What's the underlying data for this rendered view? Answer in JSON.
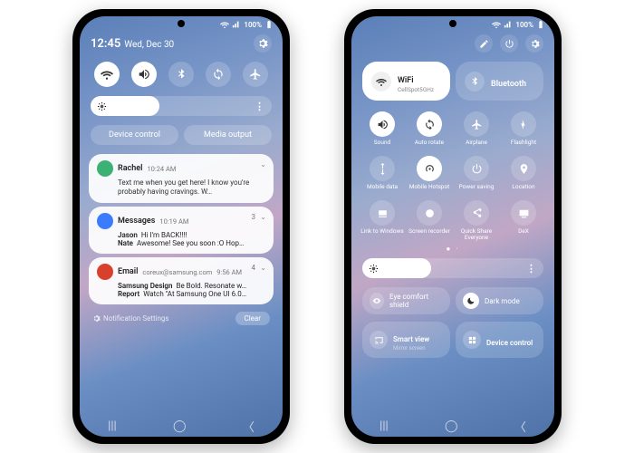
{
  "status": {
    "battery_text": "100%"
  },
  "left": {
    "time": "12:45",
    "date": "Wed, Dec 30",
    "quick_toggles": [
      {
        "name": "wifi",
        "on": true
      },
      {
        "name": "sound",
        "on": true
      },
      {
        "name": "bluetooth",
        "on": false
      },
      {
        "name": "auto-rotate",
        "on": false
      },
      {
        "name": "airplane",
        "on": false
      }
    ],
    "brightness_percent": 38,
    "chips": {
      "device_control": "Device control",
      "media_output": "Media output"
    },
    "notifications": [
      {
        "app": "messages",
        "icon_color": "#3bb273",
        "title": "Rachel",
        "time": "10:24 AM",
        "body": "Text me when you get here! I know you're probably having cravings. W…",
        "count": ""
      },
      {
        "app": "messages",
        "icon_color": "#3a7bff",
        "title": "Messages",
        "time": "10:19 AM",
        "count": "3",
        "lines": [
          {
            "name": "Jason",
            "text": "Hi I'm BACK!!!!"
          },
          {
            "name": "Nate",
            "text": "Awesome! See you soon :O Hop…"
          }
        ]
      },
      {
        "app": "email",
        "icon_color": "#d9402b",
        "title": "Email",
        "subtitle": "coreux@samsung.com",
        "time": "9:56 AM",
        "count": "4",
        "lines": [
          {
            "name": "Samsung Design",
            "text": "Be Bold. Resonate w…"
          },
          {
            "name": "Report",
            "text": "Watch \"At Samsung One UI 6.0…"
          }
        ]
      }
    ],
    "footer": {
      "settings": "Notification Settings",
      "clear": "Clear"
    }
  },
  "right": {
    "big_tiles": [
      {
        "name": "WiFi",
        "sub": "CellSpot5GHz",
        "on": true
      },
      {
        "name": "Bluetooth",
        "sub": "",
        "on": false
      }
    ],
    "grid": [
      {
        "label": "Sound",
        "icon": "sound",
        "on": true
      },
      {
        "label": "Auto rotate",
        "icon": "rotate",
        "on": true
      },
      {
        "label": "Airplane",
        "icon": "airplane",
        "on": false
      },
      {
        "label": "Flashlight",
        "icon": "flashlight",
        "on": false
      },
      {
        "label": "Mobile data",
        "icon": "data",
        "on": false
      },
      {
        "label": "Mobile Hotspot",
        "icon": "hotspot",
        "on": true
      },
      {
        "label": "Power saving",
        "icon": "power",
        "on": false
      },
      {
        "label": "Location",
        "icon": "location",
        "on": false
      },
      {
        "label": "Link to Windows",
        "icon": "link",
        "on": false
      },
      {
        "label": "Screen recorder",
        "icon": "record",
        "on": false
      },
      {
        "label": "Quick Share Everyone",
        "icon": "share",
        "on": false
      },
      {
        "label": "DeX",
        "icon": "dex",
        "on": false
      }
    ],
    "brightness_percent": 38,
    "toggles": [
      {
        "label": "Eye comfort shield",
        "icon": "eye",
        "on": false
      },
      {
        "label": "Dark mode",
        "icon": "moon",
        "on": true
      }
    ],
    "bottom_tiles": [
      {
        "label": "Smart view",
        "sub": "Mirror screen",
        "icon": "cast"
      },
      {
        "label": "Device control",
        "sub": "",
        "icon": "grid"
      }
    ]
  }
}
